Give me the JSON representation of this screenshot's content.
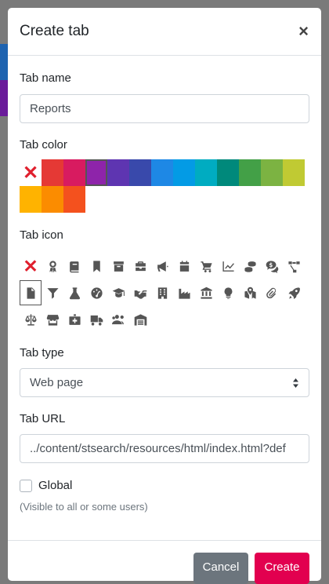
{
  "modal": {
    "title": "Create tab",
    "close_glyph": "×"
  },
  "tab_name": {
    "label": "Tab name",
    "value": "Reports"
  },
  "tab_color": {
    "label": "Tab color",
    "none_glyph": "✕",
    "colors": [
      "#e53935",
      "#d81b60",
      "#8e24aa",
      "#5e35b1",
      "#3949ab",
      "#1e88e5",
      "#039be5",
      "#00acc1",
      "#00897b",
      "#43a047",
      "#7cb342",
      "#c0ca33",
      "#ffb300",
      "#fb8c00",
      "#f4511e"
    ],
    "selected_index": 2
  },
  "tab_icon": {
    "label": "Tab icon",
    "none_glyph": "✕",
    "icons": [
      "award-icon",
      "book-icon",
      "bookmark-icon",
      "archive-icon",
      "briefcase-icon",
      "bullhorn-icon",
      "calendar-icon",
      "cart-icon",
      "chart-line-icon",
      "coins-icon",
      "comments-dollar-icon",
      "project-diagram-icon",
      "file-icon",
      "filter-icon",
      "flask-icon",
      "tachometer-icon",
      "graduation-cap-icon",
      "handshake-icon",
      "building-icon",
      "industry-icon",
      "landmark-icon",
      "lightbulb-icon",
      "map-marked-icon",
      "paperclip-icon",
      "rocket-icon",
      "balance-scale-icon",
      "store-icon",
      "first-aid-icon",
      "truck-icon",
      "users-icon",
      "warehouse-icon"
    ],
    "selected": "file-icon"
  },
  "tab_type": {
    "label": "Tab type",
    "value": "Web page"
  },
  "tab_url": {
    "label": "Tab URL",
    "value": "../content/stsearch/resources/html/index.html?def"
  },
  "global": {
    "label": "Global",
    "checked": false,
    "hint": "(Visible to all or some users)"
  },
  "buttons": {
    "cancel": "Cancel",
    "create": "Create"
  },
  "colors": {
    "primary": "#e2004f",
    "secondary": "#6c757d",
    "danger": "#e0202e"
  }
}
